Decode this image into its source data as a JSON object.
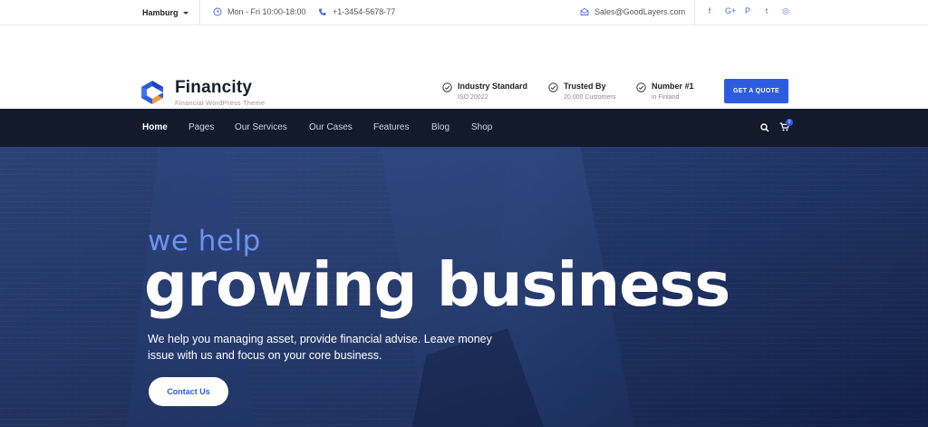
{
  "topbar": {
    "location": "Hamburg",
    "hours": "Mon - Fri 10:00-18:00",
    "phone": "+1-3454-5678-77",
    "email": "Sales@GoodLayers.com",
    "social": [
      {
        "name": "facebook-icon",
        "glyph": "f"
      },
      {
        "name": "google-plus-icon",
        "glyph": "G+"
      },
      {
        "name": "pinterest-icon",
        "glyph": "P"
      },
      {
        "name": "twitter-icon",
        "glyph": "t"
      },
      {
        "name": "instagram-icon",
        "glyph": "◎"
      }
    ]
  },
  "header": {
    "brand": "Financity",
    "tagline": "Financial WordPress Theme",
    "features": [
      {
        "title": "Industry Standard",
        "sub": "ISO 20022"
      },
      {
        "title": "Trusted By",
        "sub": "20,000 Customers"
      },
      {
        "title": "Number #1",
        "sub": "in Finland"
      }
    ],
    "quote_button": "GET A QUOTE"
  },
  "nav": {
    "items": [
      "Home",
      "Pages",
      "Our Services",
      "Our Cases",
      "Features",
      "Blog",
      "Shop"
    ],
    "cart_count": "0"
  },
  "hero": {
    "small_title": "we help",
    "big_title": "growing business",
    "description": "We help you managing asset, provide financial advise. Leave money issue with us and focus on your core business.",
    "button": "Contact Us"
  },
  "colors": {
    "accent": "#2d5ce0",
    "nav_bg": "#121a2c",
    "hero_small": "#6c92f0"
  }
}
